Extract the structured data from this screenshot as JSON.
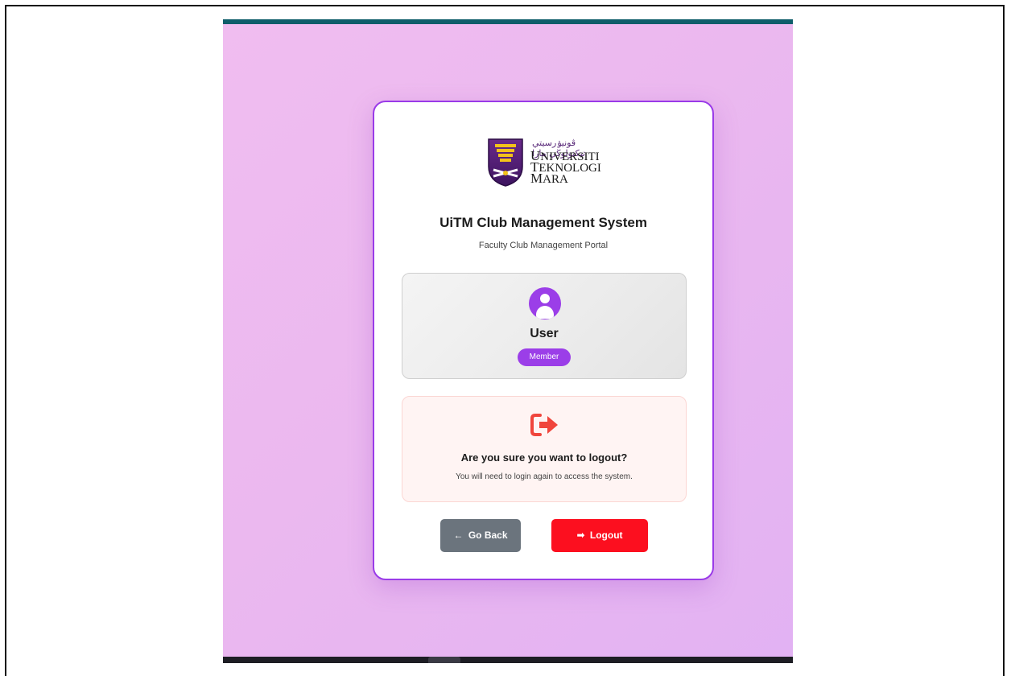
{
  "logo": {
    "jawi": "ڤونيۏرسيتي تيكنولوڬي مارا",
    "line1_cap": "U",
    "line1_rest": "NIVERSITI",
    "line2_cap": "T",
    "line2_rest": "EKNOLOGI",
    "line3_cap": "M",
    "line3_rest": "ARA"
  },
  "header": {
    "title": "UiTM Club Management System",
    "subtitle": "Faculty Club Management Portal"
  },
  "user": {
    "name": "User",
    "role": "Member"
  },
  "confirm": {
    "question": "Are you sure you want to logout?",
    "hint": "You will need to login again to access the system."
  },
  "actions": {
    "back_glyph": "←",
    "back_label": "Go Back",
    "logout_glyph": "➡",
    "logout_label": "Logout"
  },
  "colors": {
    "accent": "#9b3ee8",
    "danger": "#fc0f1f",
    "danger_icon": "#f0453c",
    "secondary": "#6b747d"
  },
  "icons": {
    "avatar": "user-circle-icon",
    "logout": "sign-out-icon"
  }
}
